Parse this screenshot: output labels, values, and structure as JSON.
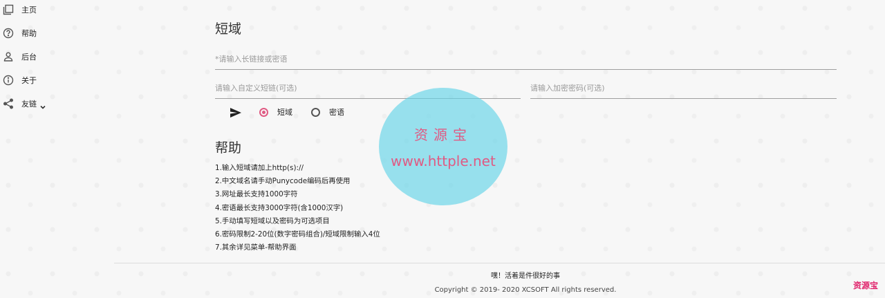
{
  "sidebar": {
    "items": [
      {
        "label": "主页",
        "icon": "pages-icon"
      },
      {
        "label": "帮助",
        "icon": "help-icon"
      },
      {
        "label": "后台",
        "icon": "user-icon"
      },
      {
        "label": "关于",
        "icon": "info-icon"
      },
      {
        "label": "友链",
        "icon": "share-icon",
        "has_dropdown": true
      }
    ]
  },
  "main": {
    "title": "短域",
    "long_url": {
      "placeholder": "*请输入长链接或密语",
      "value": ""
    },
    "custom_short": {
      "placeholder": "请输入自定义短链(可选)",
      "value": ""
    },
    "password": {
      "placeholder": "请输入加密密码(可选)",
      "value": ""
    },
    "mode_options": [
      {
        "label": "短域",
        "selected": true
      },
      {
        "label": "密语",
        "selected": false
      }
    ]
  },
  "help": {
    "title": "帮助",
    "items": [
      "1.输入短域请加上http(s)://",
      "2.中文域名请手动Punycode编码后再使用",
      "3.网址最长支持1000字符",
      "4.密语最长支持3000字符(含1000汉字)",
      "5.手动填写短域以及密码为可选项目",
      "6.密码限制2-20位(数字密码组合)/短域限制输入4位",
      "7.其余详见菜单-帮助界面"
    ]
  },
  "watermark": {
    "title": "资源宝",
    "url": "www.httple.net"
  },
  "footer": {
    "motto": "嘿！活着是件很好的事",
    "copyright": "Copyright © 2019- 2020 XCSOFT All rights reserved.",
    "logo_text": "资源宝"
  },
  "colors": {
    "accent": "#e05a83",
    "watermark_fill": "#64d4e8",
    "logo": "#e0246c"
  }
}
